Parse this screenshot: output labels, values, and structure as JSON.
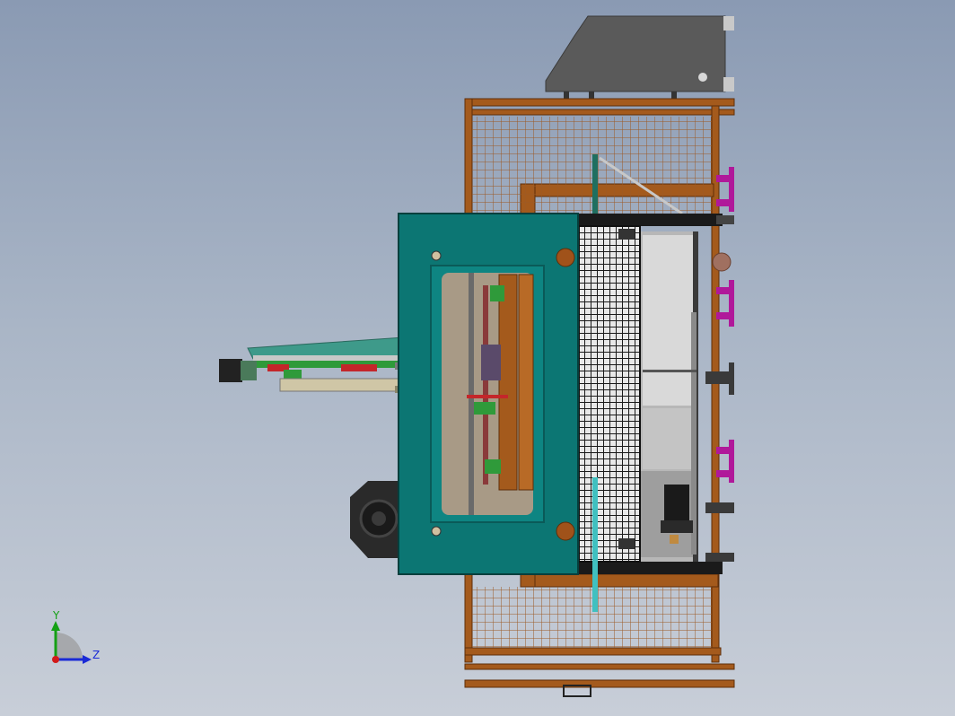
{
  "view": {
    "background_top": "#8a9ab3",
    "background_bottom": "#c8ced8"
  },
  "colors": {
    "frame_orange": "#a45a1c",
    "frame_dark": "#6e3a10",
    "teal_panel": "#0c7673",
    "teal_dark": "#08514f",
    "sheet_metal": "#5c5c5c",
    "guard_black": "#1a1a1a",
    "magenta_fitting": "#b0189a",
    "green_part": "#2f9a3a",
    "red_part": "#c4262a"
  },
  "triad": {
    "y_label": "Y",
    "z_label": "Z",
    "y_color": "#14a014",
    "z_color": "#1a2ad6",
    "x_color": "#d21a1a"
  }
}
